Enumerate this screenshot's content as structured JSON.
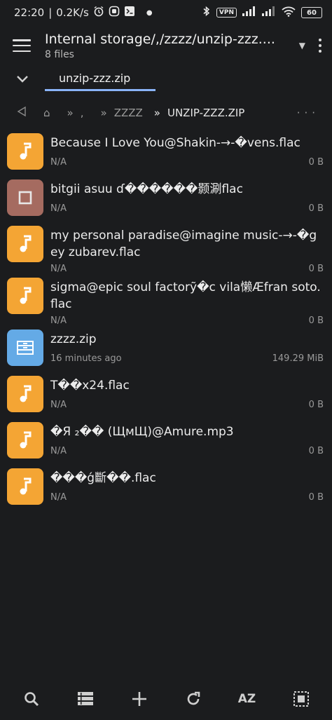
{
  "status_bar": {
    "time": "22:20",
    "speed": "0.2K/s",
    "vpn": "VPN",
    "battery": "60",
    "icons": [
      "alarm-icon",
      "app-icon",
      "terminal-icon",
      "dot-icon",
      "bluetooth-icon",
      "vpn-icon",
      "signal-icon",
      "hd-signal-icon",
      "wifi-icon",
      "battery-icon"
    ]
  },
  "app_bar": {
    "title": "Internal storage/,/zzzz/unzip-zzz....",
    "subtitle": "8 files"
  },
  "tabs": [
    {
      "label": "unzip-zzz.zip",
      "active": true
    }
  ],
  "breadcrumb": {
    "home_icon": "home-icon",
    "segments": [
      ",",
      "ZZZZ",
      "UNZIP-ZZZ.ZIP"
    ],
    "separator": "»"
  },
  "files": [
    {
      "name": "Because I Love You@Shakin-→-�vens.flac",
      "meta": "N/A",
      "size": "0 B",
      "icon": "music-icon"
    },
    {
      "name": "bitgii asuu ɗ������颢涮flac",
      "meta": "N/A",
      "size": "0 B",
      "icon": "file-icon"
    },
    {
      "name": "my personal paradise@imagine music-→-�gey zubarev.flac",
      "meta": "N/A",
      "size": "0 B",
      "icon": "music-icon"
    },
    {
      "name": "sigma@epic soul factorỹ�c vila懒Æfran soto.flac",
      "meta": "N/A",
      "size": "0 B",
      "icon": "music-icon"
    },
    {
      "name": "zzzz.zip",
      "meta": "16 minutes ago",
      "size": "149.29 MiB",
      "icon": "archive-icon"
    },
    {
      "name": "T��x24.flac",
      "meta": "N/A",
      "size": "0 B",
      "icon": "music-icon"
    },
    {
      "name": "�Я ₂�� (ЩмЩ)@Amure.mp3",
      "meta": "N/A",
      "size": "0 B",
      "icon": "music-icon"
    },
    {
      "name": "���ǵ斷��.flac",
      "meta": "N/A",
      "size": "0 B",
      "icon": "music-icon"
    }
  ],
  "bottom_bar": {
    "sort_label": "AZ",
    "icons": [
      "search-icon",
      "list-view-icon",
      "add-icon",
      "refresh-icon",
      "sort-icon",
      "select-all-icon"
    ]
  },
  "colors": {
    "background": "#1b1c1e",
    "music_icon": "#f4a534",
    "file_icon": "#a56b60",
    "archive_icon": "#64aae6",
    "tab_indicator": "#8ab4f8"
  }
}
